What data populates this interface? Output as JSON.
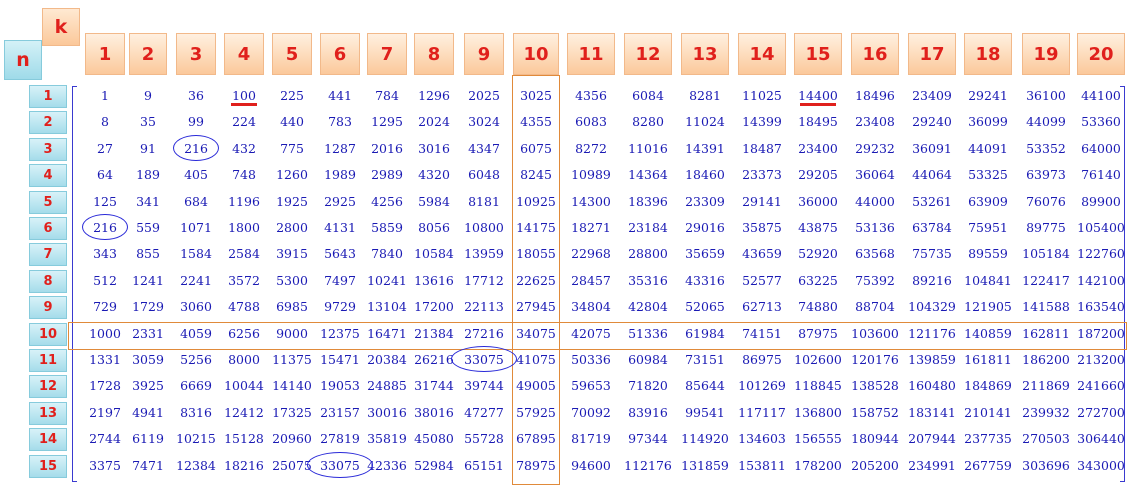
{
  "corner": {
    "k": "k",
    "n": "n"
  },
  "k_values": [
    1,
    2,
    3,
    4,
    5,
    6,
    7,
    8,
    9,
    10,
    11,
    12,
    13,
    14,
    15,
    16,
    17,
    18,
    19,
    20
  ],
  "n_values": [
    1,
    2,
    3,
    4,
    5,
    6,
    7,
    8,
    9,
    10,
    11,
    12,
    13,
    14,
    15
  ],
  "rows": [
    [
      1,
      9,
      36,
      100,
      225,
      441,
      784,
      1296,
      2025,
      3025,
      4356,
      6084,
      8281,
      11025,
      14400,
      18496,
      23409,
      29241,
      36100,
      44100
    ],
    [
      8,
      35,
      99,
      224,
      440,
      783,
      1295,
      2024,
      3024,
      4355,
      6083,
      8280,
      11024,
      14399,
      18495,
      23408,
      29240,
      36099,
      44099,
      53360
    ],
    [
      27,
      91,
      216,
      432,
      775,
      1287,
      2016,
      3016,
      4347,
      6075,
      8272,
      11016,
      14391,
      18487,
      23400,
      29232,
      36091,
      44091,
      53352,
      64000
    ],
    [
      64,
      189,
      405,
      748,
      1260,
      1989,
      2989,
      4320,
      6048,
      8245,
      10989,
      14364,
      18460,
      23373,
      29205,
      36064,
      44064,
      53325,
      63973,
      76140
    ],
    [
      125,
      341,
      684,
      1196,
      1925,
      2925,
      4256,
      5984,
      8181,
      10925,
      14300,
      18396,
      23309,
      29141,
      36000,
      44000,
      53261,
      63909,
      76076,
      89900
    ],
    [
      216,
      559,
      1071,
      1800,
      2800,
      4131,
      5859,
      8056,
      10800,
      14175,
      18271,
      23184,
      29016,
      35875,
      43875,
      53136,
      63784,
      75951,
      89775,
      105400
    ],
    [
      343,
      855,
      1584,
      2584,
      3915,
      5643,
      7840,
      10584,
      13959,
      18055,
      22968,
      28800,
      35659,
      43659,
      52920,
      63568,
      75735,
      89559,
      105184,
      122760
    ],
    [
      512,
      1241,
      2241,
      3572,
      5300,
      7497,
      10241,
      13616,
      17712,
      22625,
      28457,
      35316,
      43316,
      52577,
      63225,
      75392,
      89216,
      104841,
      122417,
      142100
    ],
    [
      729,
      1729,
      3060,
      4788,
      6985,
      9729,
      13104,
      17200,
      22113,
      27945,
      34804,
      42804,
      52065,
      62713,
      74880,
      88704,
      104329,
      121905,
      141588,
      163540
    ],
    [
      1000,
      2331,
      4059,
      6256,
      9000,
      12375,
      16471,
      21384,
      27216,
      34075,
      42075,
      51336,
      61984,
      74151,
      87975,
      103600,
      121176,
      140859,
      162811,
      187200
    ],
    [
      1331,
      3059,
      5256,
      8000,
      11375,
      15471,
      20384,
      26216,
      33075,
      41075,
      50336,
      60984,
      73151,
      86975,
      102600,
      120176,
      139859,
      161811,
      186200,
      213200
    ],
    [
      1728,
      3925,
      6669,
      10044,
      14140,
      19053,
      24885,
      31744,
      39744,
      49005,
      59653,
      71820,
      85644,
      101269,
      118845,
      138528,
      160480,
      184869,
      211869,
      241660
    ],
    [
      2197,
      4941,
      8316,
      12412,
      17325,
      23157,
      30016,
      38016,
      47277,
      57925,
      70092,
      83916,
      99541,
      117117,
      136800,
      158752,
      183141,
      210141,
      239932,
      272700
    ],
    [
      2744,
      6119,
      10215,
      15128,
      20960,
      27819,
      35819,
      45080,
      55728,
      67895,
      81719,
      97344,
      114920,
      134603,
      156555,
      180944,
      207944,
      237735,
      270503,
      306440
    ],
    [
      3375,
      7471,
      12384,
      18216,
      25075,
      33075,
      42336,
      52984,
      65151,
      78975,
      94600,
      112176,
      131859,
      153811,
      178200,
      205200,
      234991,
      267759,
      303696,
      343000
    ]
  ],
  "highlight": {
    "column_k": 10,
    "row_n": 10,
    "circled": [
      [
        3,
        3
      ],
      [
        6,
        1
      ],
      [
        11,
        9
      ],
      [
        15,
        6
      ]
    ],
    "underlined": [
      [
        1,
        4
      ],
      [
        1,
        15
      ]
    ]
  },
  "colors": {
    "number_text": "#1a1ab4",
    "header_text": "#e0201c",
    "k_header_bg": "#fbc99b",
    "n_header_bg": "#a5dcea",
    "highlight_box": "#e08a3a",
    "circle": "#2a2ad8",
    "underline": "#e0201c"
  }
}
